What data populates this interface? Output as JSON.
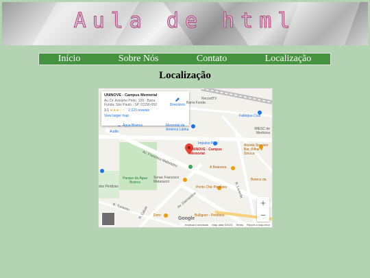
{
  "banner": {
    "title": "Aula de html"
  },
  "nav": {
    "items": [
      "Início",
      "Sobre Nós",
      "Contato",
      "Localização"
    ]
  },
  "page": {
    "title": "Localização"
  },
  "map": {
    "place_name": "UNINOVE - Campus Memorial",
    "address": "Av. Dr. Adolpho Pinto, 109 - Barra Funda, São Paulo - SP, 01156-050",
    "rating": "3.1",
    "stars": "★★★☆☆",
    "reviews": "2,123 reviews",
    "larger_map": "View larger map",
    "directions": "Directions",
    "pin_label": "UNINOVE - Campus Memorial",
    "labels": {
      "recordtv": "RecordTV",
      "barra_funda": "Barra Funda",
      "fabrique": "Fabrique Club",
      "imesc": "IMESC de Medicina",
      "agua_branca": "Água Branca",
      "memorial": "Memorial da América Latina",
      "audio": "Audio",
      "impulso": "Impulso Park",
      "atlanta": "Atlanta Snooker Bar, Bilhar e Sinuca",
      "ave_francisco": "Av. Francisco Matarazzo",
      "a_baianera": "A Baianera",
      "parque": "Parque da Água Branca",
      "senac": "Senac Francisco Matarazzo",
      "ponto_chic": "Ponto Chic Perdizes",
      "boteco": "Boteco da",
      "dos_perdizes": "dos Perdizes",
      "turiassu": "R. Turiassu",
      "caiubi": "R. Caiubi",
      "doro": "Doro",
      "bulliguer": "Bulliguer - Perdizes",
      "diamantina": "Av. Diamantina",
      "lacerda": "R. Lacerda"
    },
    "zoom_in": "+",
    "zoom_out": "−",
    "google": "Google",
    "attribution": {
      "shortcuts": "Keyboard shortcuts",
      "data": "Map data ©2023",
      "terms": "Terms",
      "report": "Report a map error"
    }
  }
}
